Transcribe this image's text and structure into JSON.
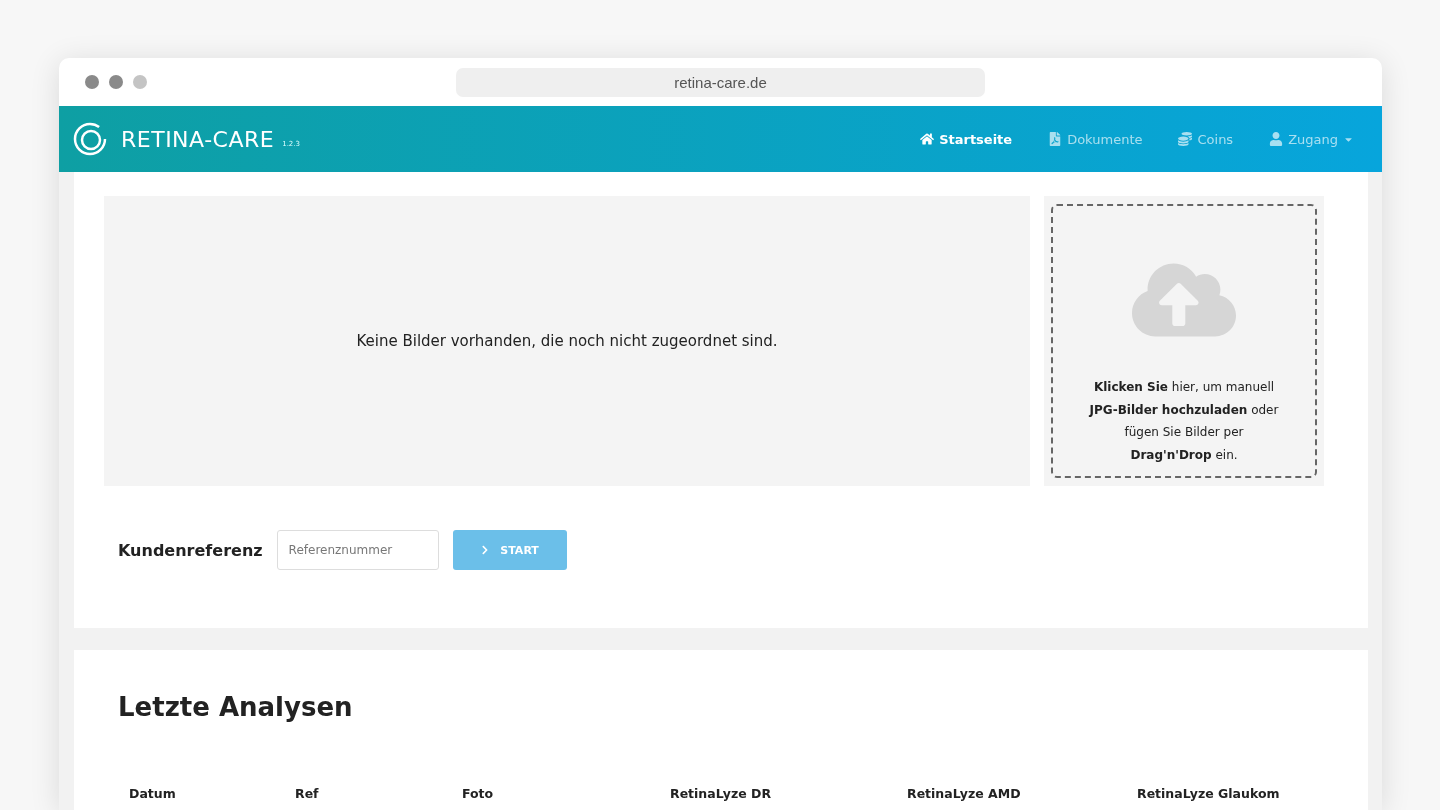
{
  "browser": {
    "url": "retina-care.de"
  },
  "navbar": {
    "brand": "RETINA-CARE",
    "version": "1.2.3",
    "items": [
      {
        "kind": "home",
        "label": "Startseite",
        "selected": true
      },
      {
        "kind": "document",
        "label": "Dokumente",
        "selected": false
      },
      {
        "kind": "coins",
        "label": "Coins",
        "selected": false
      },
      {
        "kind": "user",
        "label": "Zugang",
        "selected": false,
        "dropdown": true
      }
    ]
  },
  "images_panel": {
    "empty_message": "Keine Bilder vorhanden, die noch nicht zugeordnet sind."
  },
  "upload": {
    "lines": [
      "**Klicken Sie** hier, um manuell",
      "**JPG-Bilder hochzuladen** oder",
      "fügen Sie Bilder per",
      "**Drag'n'Drop** ein."
    ]
  },
  "reference": {
    "label": "Kundenreferenz",
    "placeholder": "Referenznummer",
    "button": "START"
  },
  "analyses": {
    "title": "Letzte Analysen",
    "columns": [
      "Datum",
      "Ref",
      "Foto",
      "RetinaLyze DR",
      "RetinaLyze AMD",
      "RetinaLyze Glaukom"
    ]
  }
}
